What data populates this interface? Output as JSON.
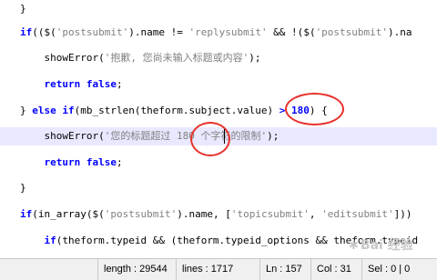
{
  "editor": {
    "lines": [
      {
        "segments": [
          {
            "t": "}",
            "c": "plain"
          }
        ]
      },
      {
        "segments": [
          {
            "t": "if",
            "c": "kw"
          },
          {
            "t": "((",
            "c": "plain"
          },
          {
            "t": "$",
            "c": "plain"
          },
          {
            "t": "(",
            "c": "plain"
          },
          {
            "t": "'postsubmit'",
            "c": "str"
          },
          {
            "t": ").name != ",
            "c": "plain"
          },
          {
            "t": "'replysubmit'",
            "c": "str"
          },
          {
            "t": " && !(",
            "c": "plain"
          },
          {
            "t": "$",
            "c": "plain"
          },
          {
            "t": "(",
            "c": "plain"
          },
          {
            "t": "'postsubmit'",
            "c": "str"
          },
          {
            "t": ").na",
            "c": "plain"
          }
        ]
      },
      {
        "segments": [
          {
            "t": "    showError(",
            "c": "plain"
          },
          {
            "t": "'抱歉, 您尚未输入标题或内容'",
            "c": "str"
          },
          {
            "t": ");",
            "c": "plain"
          }
        ]
      },
      {
        "segments": [
          {
            "t": "    ",
            "c": "plain"
          },
          {
            "t": "return",
            "c": "kw"
          },
          {
            "t": " ",
            "c": "plain"
          },
          {
            "t": "false",
            "c": "kw"
          },
          {
            "t": ";",
            "c": "plain"
          }
        ]
      },
      {
        "segments": [
          {
            "t": "} ",
            "c": "plain"
          },
          {
            "t": "else if",
            "c": "kw"
          },
          {
            "t": "(mb_strlen(theform.subject.value) ",
            "c": "plain"
          },
          {
            "t": ">",
            "c": "kw"
          },
          {
            "t": " ",
            "c": "plain"
          },
          {
            "t": "180",
            "c": "kw"
          },
          {
            "t": ") {",
            "c": "plain"
          }
        ]
      },
      {
        "segments": [
          {
            "t": "    showError(",
            "c": "plain"
          },
          {
            "t": "'您的标题超过 180 个字符的限制'",
            "c": "str"
          },
          {
            "t": ");",
            "c": "plain"
          }
        ],
        "highlighted": true
      },
      {
        "segments": [
          {
            "t": "    ",
            "c": "plain"
          },
          {
            "t": "return",
            "c": "kw"
          },
          {
            "t": " ",
            "c": "plain"
          },
          {
            "t": "false",
            "c": "kw"
          },
          {
            "t": ";",
            "c": "plain"
          }
        ]
      },
      {
        "segments": [
          {
            "t": "}",
            "c": "plain"
          }
        ]
      },
      {
        "segments": [
          {
            "t": "if",
            "c": "kw"
          },
          {
            "t": "(in_array(",
            "c": "plain"
          },
          {
            "t": "$",
            "c": "plain"
          },
          {
            "t": "(",
            "c": "plain"
          },
          {
            "t": "'postsubmit'",
            "c": "str"
          },
          {
            "t": ").name, [",
            "c": "plain"
          },
          {
            "t": "'topicsubmit'",
            "c": "str"
          },
          {
            "t": ", ",
            "c": "plain"
          },
          {
            "t": "'editsubmit'",
            "c": "str"
          },
          {
            "t": "]))",
            "c": "plain"
          }
        ]
      },
      {
        "segments": [
          {
            "t": "    ",
            "c": "plain"
          },
          {
            "t": "if",
            "c": "kw"
          },
          {
            "t": "(theform.typeid && (theform.typeid_options && theform.typeid",
            "c": "plain"
          }
        ]
      }
    ]
  },
  "status_bar": {
    "length": "length : 29544",
    "lines": "lines : 1717",
    "ln": "Ln : 157",
    "col": "Col : 31",
    "sel": "Sel : 0 | 0"
  },
  "watermark": {
    "text": "Bai 经验"
  },
  "colors": {
    "annotation": "#e8302a",
    "keyword": "#0000ff",
    "string": "#808080",
    "current_line": "#e8e8ff"
  }
}
